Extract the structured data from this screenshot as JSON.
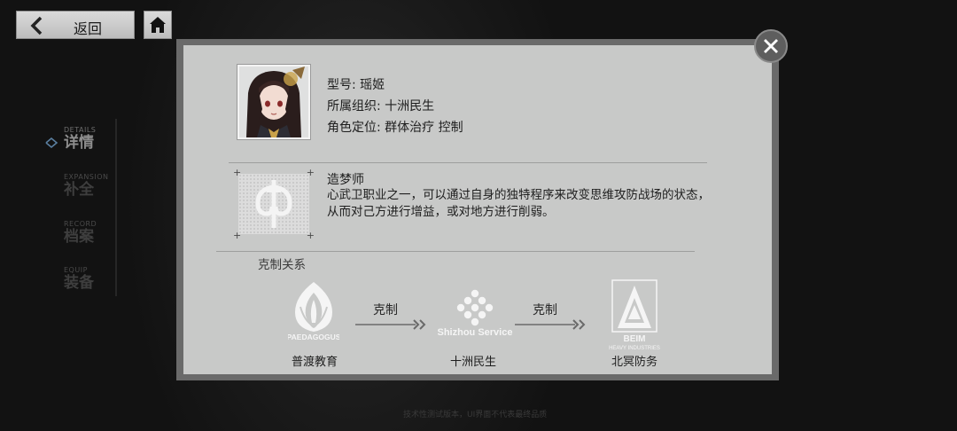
{
  "topbar": {
    "back_label": "返回",
    "back_icon": "chevron-left-icon",
    "home_icon": "home-icon"
  },
  "sidenav": {
    "items": [
      {
        "en": "DETAILS",
        "zh": "详情",
        "active": true
      },
      {
        "en": "EXPANSION",
        "zh": "补全",
        "active": false
      },
      {
        "en": "RECORD",
        "zh": "档案",
        "active": false
      },
      {
        "en": "EQUIP",
        "zh": "装备",
        "active": false
      }
    ]
  },
  "modal": {
    "close_icon": "close-icon",
    "model_label": "型号: 瑶姬",
    "org_label": "所属组织:  十洲民生",
    "role_label": "角色定位:  群体治疗 控制",
    "class_name": "造梦师",
    "class_description": "心武卫职业之一，可以通过自身的独特程序来改变思维攻防战场的状态，从而对己方进行增益，或对地方进行削弱。",
    "counter_section_title": "克制关系",
    "counter_chain": [
      {
        "logo_text": "PAEDAGOGUS",
        "name": "普渡教育"
      },
      {
        "logo_text": "Shizhou Service",
        "name": "十洲民生"
      },
      {
        "logo_text": "BEIM",
        "logo_subtext": "HEAVY INDUSTRIES",
        "name": "北冥防务"
      }
    ],
    "arrow_labels": [
      "克制",
      "克制"
    ]
  },
  "footer_note": "技术性测试版本，UI界面不代表最终品质",
  "colors": {
    "modal_bg": "#c8c9c8",
    "frame": "#6a6a6a",
    "page_bg": "#141414"
  }
}
